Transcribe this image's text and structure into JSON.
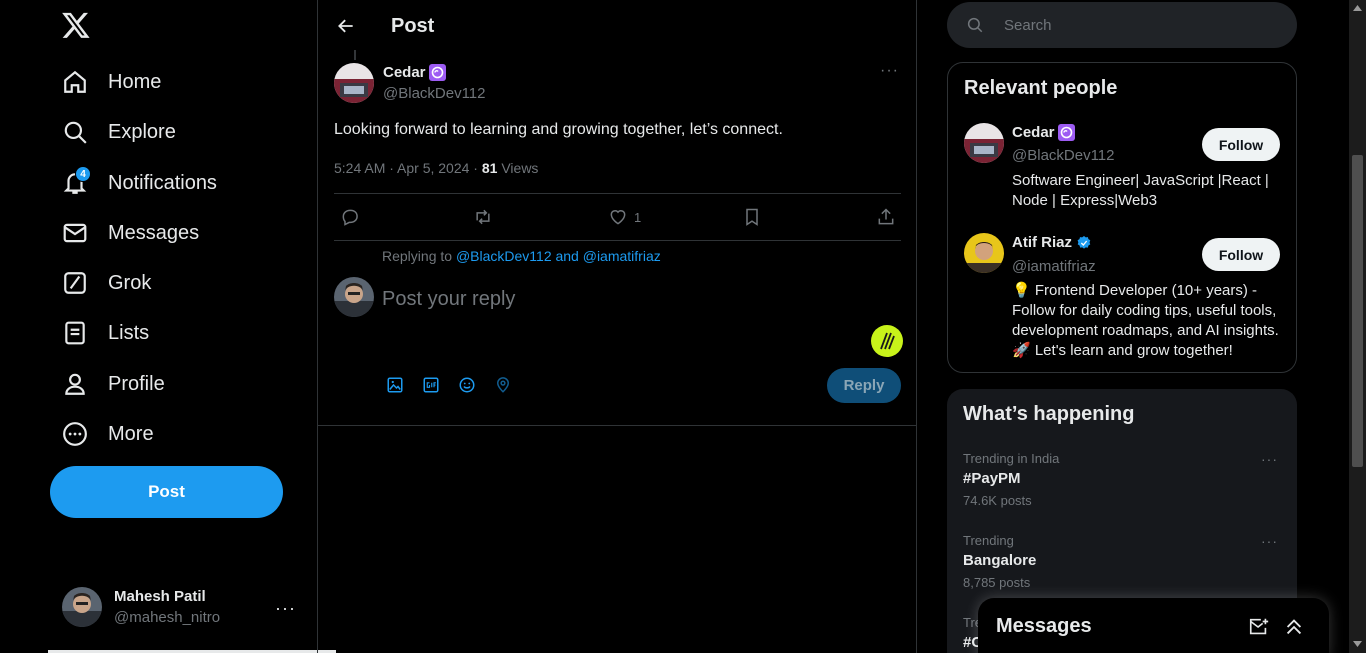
{
  "nav": {
    "items": [
      {
        "label": "Home",
        "icon": "home-icon"
      },
      {
        "label": "Explore",
        "icon": "search-icon"
      },
      {
        "label": "Notifications",
        "icon": "bell-icon",
        "badge": "4"
      },
      {
        "label": "Messages",
        "icon": "envelope-icon"
      },
      {
        "label": "Grok",
        "icon": "grok-icon"
      },
      {
        "label": "Lists",
        "icon": "list-icon"
      },
      {
        "label": "Profile",
        "icon": "person-icon"
      },
      {
        "label": "More",
        "icon": "more-circle-icon"
      }
    ],
    "post_label": "Post"
  },
  "account": {
    "name": "Mahesh Patil",
    "handle": "@mahesh_nitro",
    "more": "···"
  },
  "header": {
    "title": "Post"
  },
  "tweet": {
    "name": "Cedar",
    "handle": "@BlackDev112",
    "text": "Looking forward to learning and growing together, let’s connect.",
    "time": "5:24 AM · Apr 5, 2024 · ",
    "views_count": "81",
    "views_label": " Views",
    "likes": "1",
    "more": "···"
  },
  "reply": {
    "replying_prefix": "Replying to ",
    "replying_to": "@BlackDev112 and @iamatifriaz",
    "placeholder": "Post your reply",
    "button": "Reply"
  },
  "search": {
    "placeholder": "Search"
  },
  "relevant_people": {
    "title": "Relevant people",
    "people": [
      {
        "name": "Cedar",
        "handle": "@BlackDev112",
        "bio": "Software Engineer| JavaScript |React | Node | Express|Web3",
        "follow": "Follow"
      },
      {
        "name": "Atif Riaz",
        "handle": "@iamatifriaz",
        "bio": "💡 Frontend Developer (10+ years) - Follow for daily coding tips, useful tools, development roadmaps, and AI insights. 🚀 Let's learn and grow together!",
        "follow": "Follow"
      }
    ]
  },
  "happening": {
    "title": "What’s happening",
    "trends": [
      {
        "context": "Trending in India",
        "name": "#PayPM",
        "count": "74.6K posts",
        "more": "···"
      },
      {
        "context": "Trending",
        "name": "Bangalore",
        "count": "8,785 posts",
        "more": "···"
      },
      {
        "context": "Tre",
        "name": "#C",
        "count": "",
        "more": ""
      }
    ]
  },
  "messages_drawer": {
    "title": "Messages"
  },
  "colors": {
    "accent": "#1d9bf0",
    "background": "#000000",
    "muted": "#71767b"
  }
}
